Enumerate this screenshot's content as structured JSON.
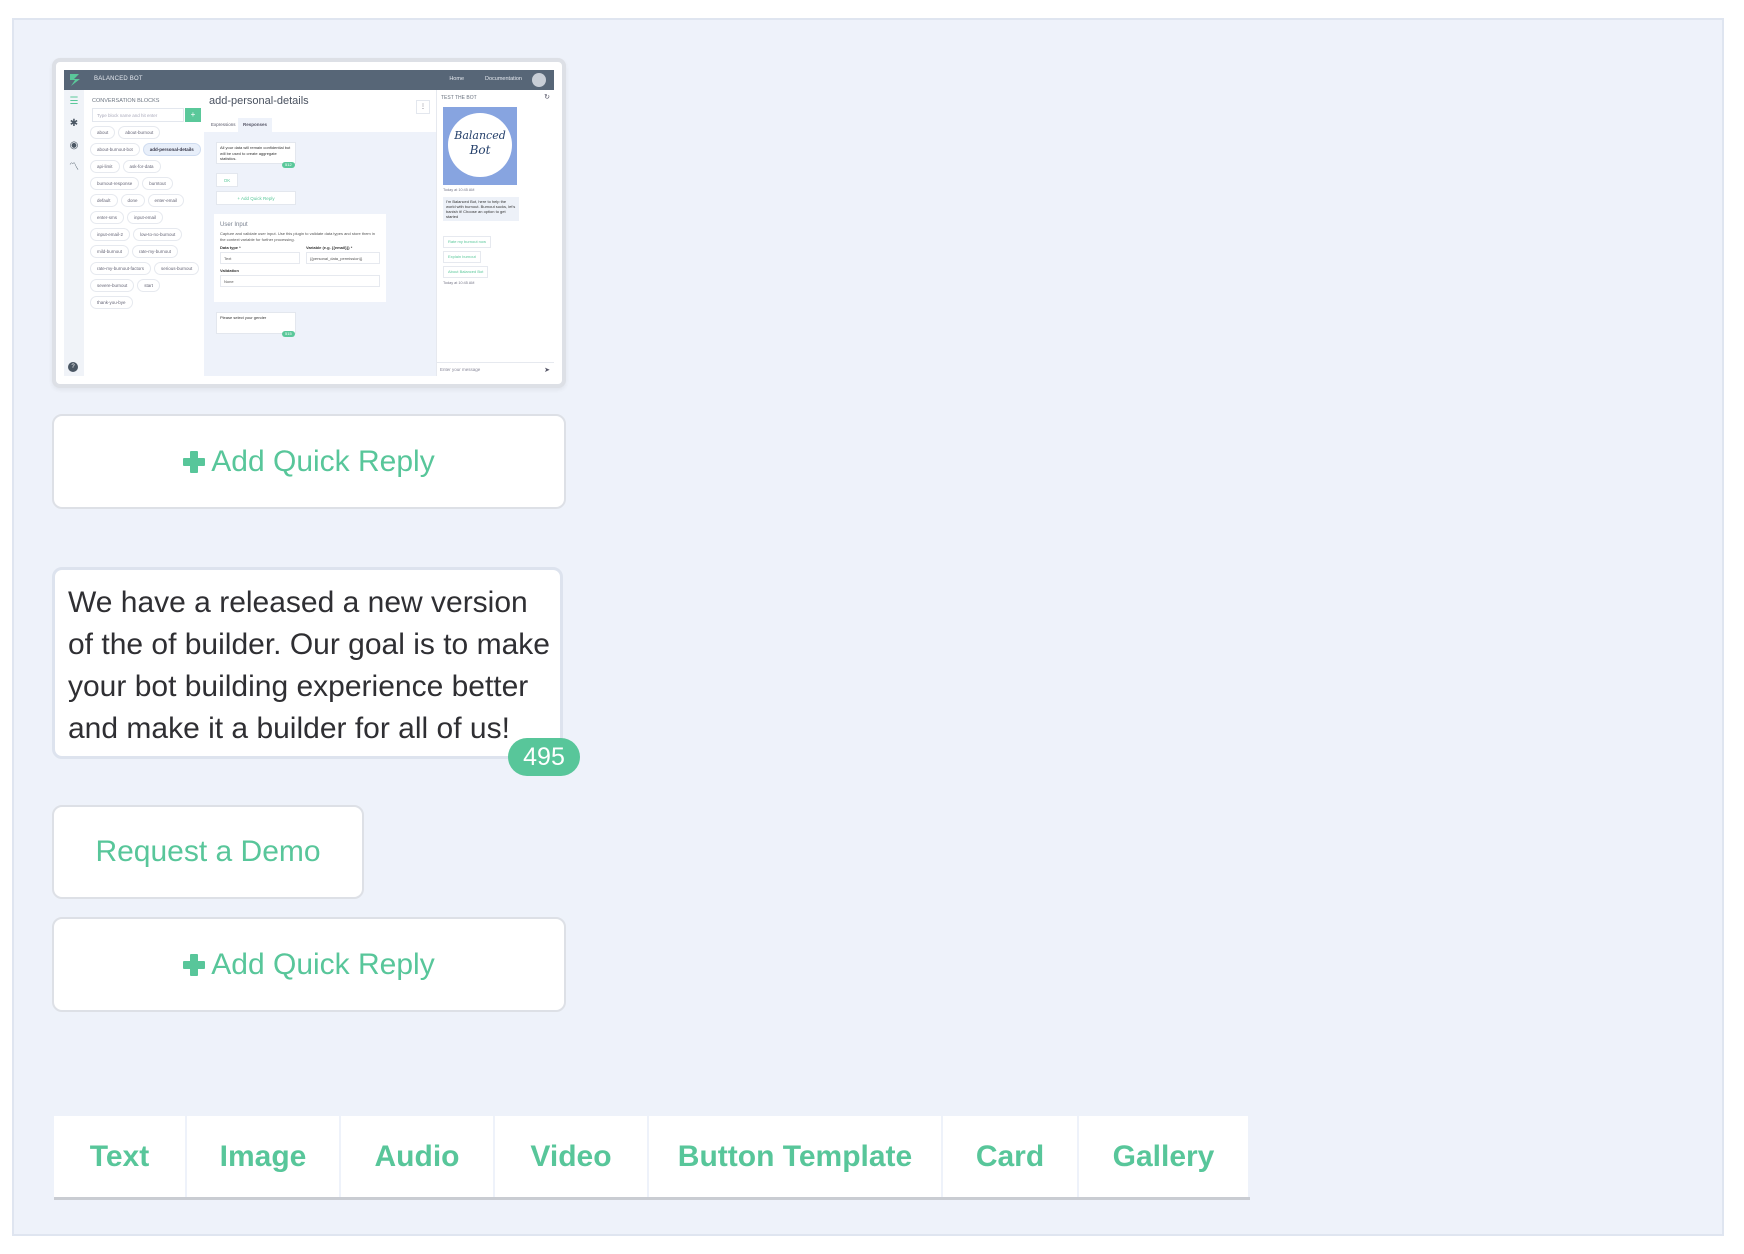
{
  "colors": {
    "accent": "#58c69a",
    "background": "#eef2fa",
    "border": "#dde0e6"
  },
  "thumbnail": {
    "brand": "BALANCED BOT",
    "nav": [
      "Home",
      "Documentation"
    ],
    "sidebar_title": "CONVERSATION BLOCKS",
    "search_placeholder": "Type block name and hit enter",
    "add_label": "+",
    "blocks": [
      "about",
      "about-burnout",
      "about-burnout-bot",
      "add-personal-details",
      "api-limit",
      "ask-for-data",
      "burnout-response",
      "burntout",
      "default",
      "done",
      "enter-email",
      "enter-sms",
      "input-email",
      "input-email-2",
      "low-to-no-burnout",
      "mild-burnout",
      "rate-my-burnout",
      "rate-my-burnout-factors",
      "serious-burnout",
      "severe-burnout",
      "start",
      "thank-you-bye"
    ],
    "active_block": "add-personal-details",
    "block_title": "add-personal-details",
    "tabs": [
      "Expressions",
      "Responses"
    ],
    "response_text": "All your data will remain confidential but will be used to create aggregate statistics.",
    "response_count": "512",
    "ok_reply": "OK",
    "add_quick_reply": "+ Add Quick Reply",
    "user_input": {
      "title": "User Input",
      "description": "Capture and validate user input. Use this plugin to validate data types and store them in the context variable for further processing.",
      "data_type_label": "Data type *",
      "data_type_value": "Text",
      "variable_label": "Variable (e.g. {{email}}) *",
      "variable_value": "{{personal_data_permission}}",
      "validation_label": "Validation",
      "validation_value": "None"
    },
    "gender_prompt": "Please select your gender",
    "gender_count": "515",
    "test_title": "TEST THE BOT",
    "bot_image_line1": "Balanced",
    "bot_image_line2": "Bot",
    "timestamp": "Today at 10:45 AM",
    "bot_message": "I'm Balanced Bot, here to help the world with burnout. Burnout sucks, let's banish it! Choose an option to get started",
    "options": [
      "Rate my burnout now",
      "Explain burnout",
      "About Balanced Bot"
    ],
    "message_placeholder": "Enter your message"
  },
  "quick_reply_1": {
    "label": "Add Quick Reply",
    "icon": "plus-icon"
  },
  "text_response": {
    "value": "We have a released a new version of the of builder.  Our goal is to make your bot building experience better and make it a builder for all of us!",
    "remaining_chars": "495"
  },
  "demo_button": {
    "label": "Request a Demo"
  },
  "quick_reply_2": {
    "label": "Add Quick Reply",
    "icon": "plus-icon"
  },
  "response_types": [
    "Text",
    "Image",
    "Audio",
    "Video",
    "Button Template",
    "Card",
    "Gallery"
  ]
}
